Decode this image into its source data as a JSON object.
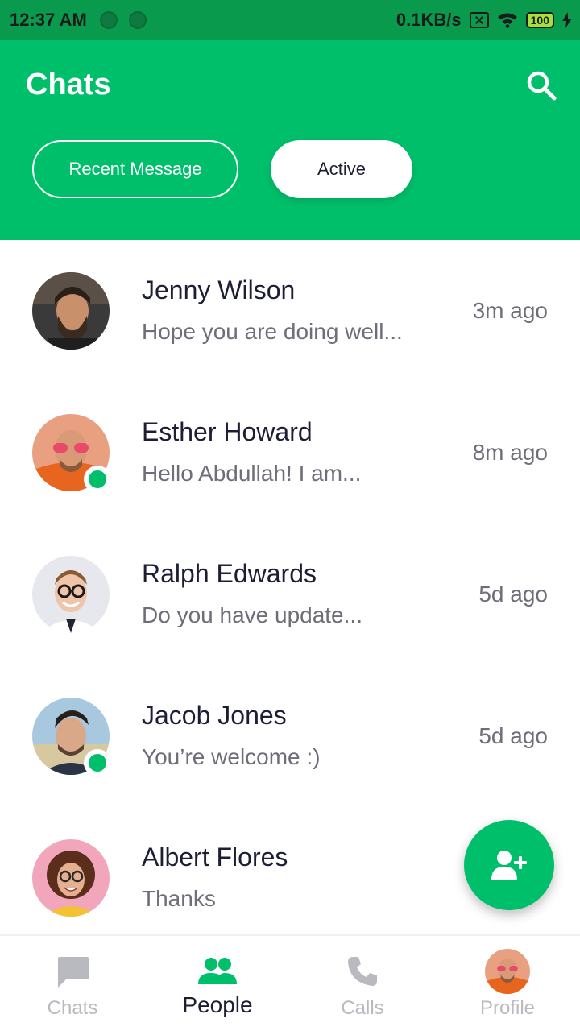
{
  "status_bar": {
    "time": "12:37 AM",
    "speed": "0.1KB/s",
    "battery": "100"
  },
  "header": {
    "title": "Chats",
    "tabs": [
      {
        "label": "Recent Message"
      },
      {
        "label": "Active"
      }
    ]
  },
  "chats": [
    {
      "name": "Jenny Wilson",
      "message": "Hope you are doing well...",
      "time": "3m ago",
      "online": false
    },
    {
      "name": "Esther Howard",
      "message": "Hello Abdullah! I am...",
      "time": "8m ago",
      "online": true
    },
    {
      "name": "Ralph Edwards",
      "message": "Do you have update...",
      "time": "5d ago",
      "online": false
    },
    {
      "name": "Jacob Jones",
      "message": "You’re welcome :)",
      "time": "5d ago",
      "online": true
    },
    {
      "name": "Albert Flores",
      "message": "Thanks",
      "time": "",
      "online": false
    }
  ],
  "bottom_nav": {
    "items": [
      {
        "label": "Chats",
        "icon": "chat-bubble-icon"
      },
      {
        "label": "People",
        "icon": "people-icon"
      },
      {
        "label": "Calls",
        "icon": "phone-icon"
      },
      {
        "label": "Profile",
        "icon": "profile-avatar"
      }
    ],
    "active": "People"
  },
  "colors": {
    "primary": "#00bf6a",
    "status_bar": "#0a9a4e",
    "text_dark": "#1d1d35",
    "text_muted": "#6e6e7a",
    "nav_inactive": "#b9b9c0"
  }
}
